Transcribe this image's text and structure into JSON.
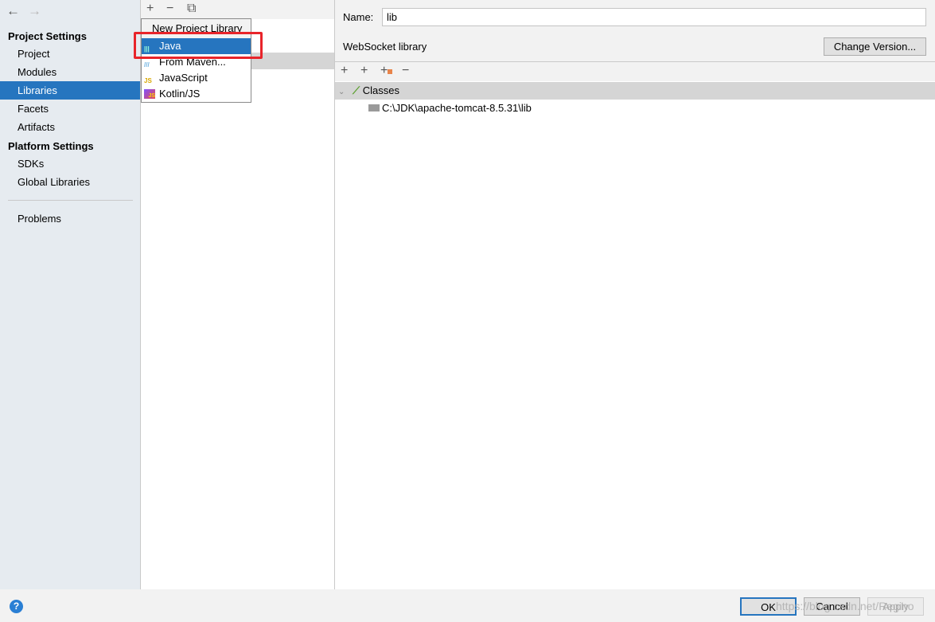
{
  "nav": {
    "back": "←",
    "forward": "→"
  },
  "sidebar": {
    "project_settings": "Project Settings",
    "items": [
      {
        "label": "Project"
      },
      {
        "label": "Modules"
      },
      {
        "label": "Libraries"
      },
      {
        "label": "Facets"
      },
      {
        "label": "Artifacts"
      }
    ],
    "platform_settings": "Platform Settings",
    "platform_items": [
      {
        "label": "SDKs"
      },
      {
        "label": "Global Libraries"
      }
    ],
    "problems": "Problems"
  },
  "toolbar": {
    "add": "+",
    "remove": "−",
    "copy": "⧉"
  },
  "popup": {
    "title": "New Project Library",
    "items": [
      {
        "label": "Java",
        "selected": true
      },
      {
        "label": "From Maven..."
      },
      {
        "label": "JavaScript"
      },
      {
        "label": "Kotlin/JS"
      }
    ]
  },
  "detail": {
    "name_label": "Name:",
    "name_value": "lib",
    "library_label": "WebSocket library",
    "change_version": "Change Version...",
    "toolbar": {
      "add": "+",
      "add_alt": "+",
      "add_dir": "+",
      "remove": "−"
    },
    "tree": {
      "root": "Classes",
      "child": "C:\\JDK\\apache-tomcat-8.5.31\\lib"
    }
  },
  "footer": {
    "help": "?",
    "ok": "OK",
    "cancel": "Cancel",
    "apply": "Apply",
    "watermark": "https://blog.csdn.net/Regino"
  },
  "colors": {
    "selection": "#2675bf",
    "highlight_box": "#e8242a"
  }
}
